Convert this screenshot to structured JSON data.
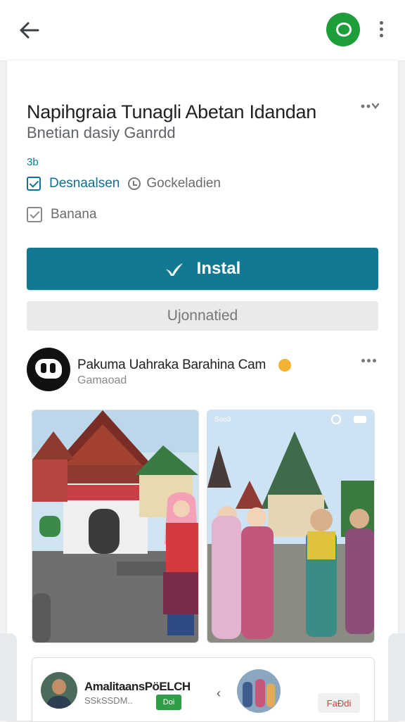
{
  "topbar": {
    "back_icon": "arrow-left-icon",
    "chat_icon": "chat-bubble-icon",
    "menu_icon": "more-vertical-icon",
    "accent": "#1e9e3a"
  },
  "app": {
    "title": "Napihgraia Tunagli Abetan Idandan",
    "subtitle": "Bnetian dasiy Ganrdd",
    "rating": "3b",
    "badge_primary": "Desnaalsen",
    "badge_secondary": "Gockeladien",
    "wishlist_label": "Banana",
    "install_label": "Instal",
    "secondary_label": "Ujonnatied",
    "accent": "#117a92"
  },
  "post": {
    "author": "Pakuma Uahraka Barahina Cam",
    "sub": "Gamaoad",
    "photo_label": "Soo3"
  },
  "review": {
    "name": "AmalitaansPöELCH",
    "sub": "SSkSSDM..",
    "tag": "Doi",
    "arrow": "‹",
    "action": "FaƉdi"
  }
}
